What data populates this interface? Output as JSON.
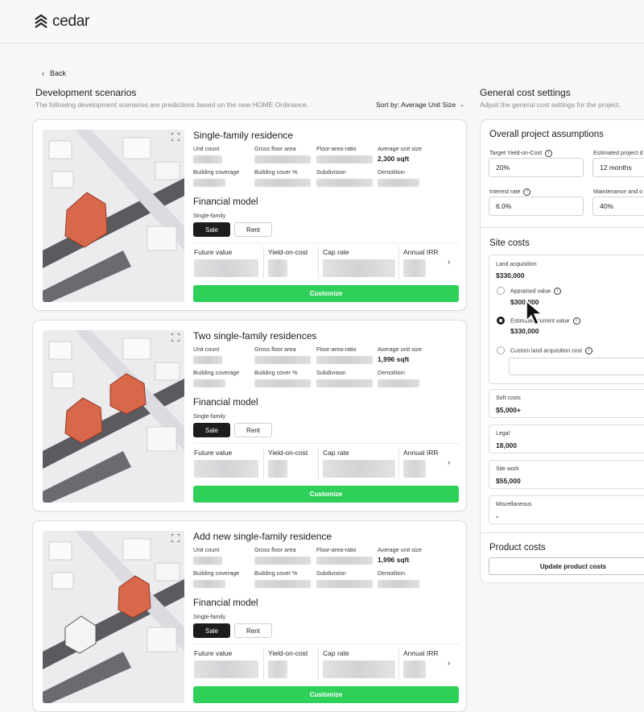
{
  "brand": {
    "name": "cedar"
  },
  "nav": {
    "back_label": "Back"
  },
  "scenarios": {
    "title": "Development scenarios",
    "subtitle": "The following development scenarios are predictions based on the new HOME Ordinance.",
    "sort_label": "Sort by: Average Unit Size",
    "metric_labels": {
      "unit_count": "Unit count",
      "gross_floor_area": "Gross floor area",
      "far": "Floor-area-ratio",
      "avg_unit_size": "Average unit size",
      "building_coverage": "Building coverage",
      "building_cover_pct": "Building cover %",
      "subdivision": "Subdivision",
      "demolition": "Demolition"
    },
    "financial": {
      "title": "Financial model",
      "type_label": "Single-family",
      "sale_label": "Sale",
      "rent_label": "Rent",
      "future_value": "Future value",
      "yield_on_cost": "Yield-on-cost",
      "cap_rate": "Cap rate",
      "annual_irr": "Annual IRR",
      "customize_label": "Customize"
    },
    "cards": [
      {
        "title": "Single-family residence",
        "avg_unit_size": "2,300 sqft"
      },
      {
        "title": "Two single-family residences",
        "avg_unit_size": "1,996 sqft"
      },
      {
        "title": "Add new single-family residence",
        "avg_unit_size": "1,996 sqft"
      }
    ]
  },
  "settings": {
    "title": "General cost settings",
    "subtitle": "Adjust the general cost settings for the project.",
    "assumptions": {
      "title": "Overall project assumptions",
      "target_yield_label": "Target Yield-on-Cost",
      "target_yield_value": "20%",
      "est_project_label": "Estimated project d",
      "est_project_value": "12 months",
      "interest_label": "Interest rate",
      "interest_value": "6.0%",
      "maintenance_label": "Maintenance and o",
      "maintenance_value": "40%"
    },
    "site_costs": {
      "title": "Site costs",
      "land_label": "Land acquisition",
      "land_value": "$330,000",
      "appraised_label": "Appraised value",
      "appraised_value": "$300,000",
      "estimated_label": "Estimated current value",
      "estimated_value": "$330,000",
      "custom_label": "Custom land acquisition cost",
      "soft_label": "Soft costs",
      "soft_value": "$5,000+",
      "legal_label": "Legal",
      "legal_value": "18,000",
      "sitework_label": "Site work",
      "sitework_value": "$55,000",
      "misc_label": "Miscellaneous",
      "misc_value": "-"
    },
    "product_costs": {
      "title": "Product costs",
      "update_label": "Update product costs"
    }
  },
  "colors": {
    "accent_green": "#2fd05a",
    "dark": "#1d1d1f",
    "roof": "#d9674a"
  }
}
